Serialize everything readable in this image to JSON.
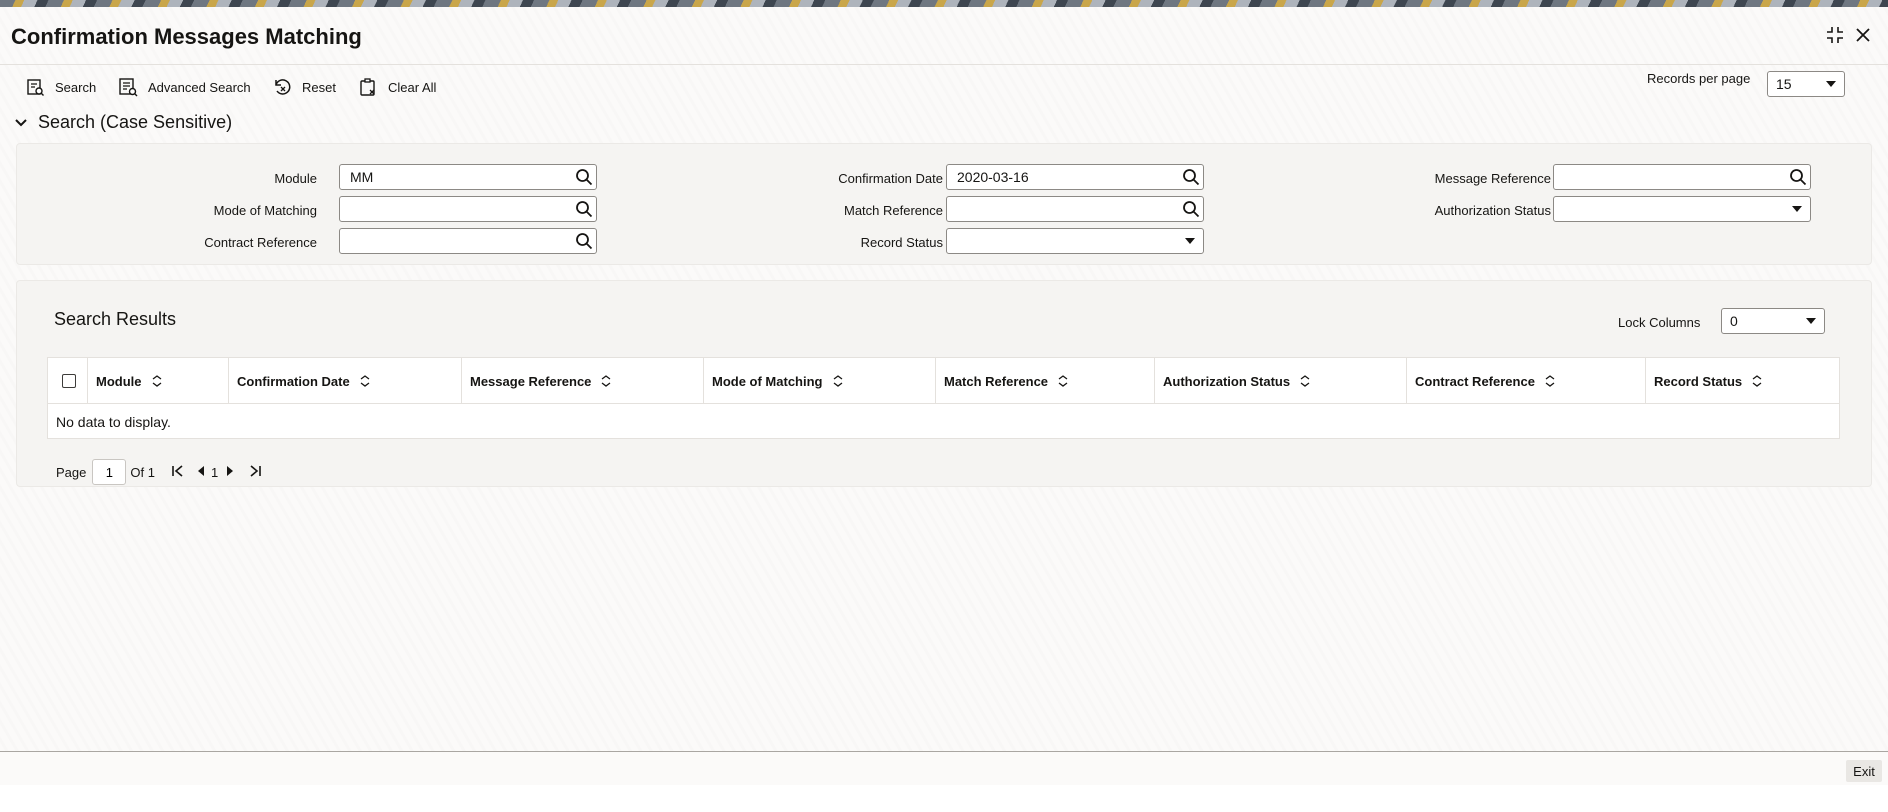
{
  "window": {
    "title": "Confirmation Messages Matching"
  },
  "toolbar": {
    "search": "Search",
    "advanced_search": "Advanced Search",
    "reset": "Reset",
    "clear_all": "Clear All",
    "records_per_page_label": "Records per page",
    "records_per_page_value": "15"
  },
  "search_section": {
    "title": "Search (Case Sensitive)",
    "fields": {
      "module": {
        "label": "Module",
        "value": "MM"
      },
      "mode_of_matching": {
        "label": "Mode of Matching",
        "value": ""
      },
      "contract_reference": {
        "label": "Contract Reference",
        "value": ""
      },
      "confirmation_date": {
        "label": "Confirmation Date",
        "value": "2020-03-16"
      },
      "match_reference": {
        "label": "Match Reference",
        "value": ""
      },
      "record_status": {
        "label": "Record Status",
        "value": ""
      },
      "message_reference": {
        "label": "Message Reference",
        "value": ""
      },
      "authorization_status": {
        "label": "Authorization Status",
        "value": ""
      }
    }
  },
  "results": {
    "title": "Search Results",
    "lock_columns_label": "Lock Columns",
    "lock_columns_value": "0",
    "columns": [
      "Module",
      "Confirmation Date",
      "Message Reference",
      "Mode of Matching",
      "Match Reference",
      "Authorization Status",
      "Contract Reference",
      "Record Status"
    ],
    "empty_text": "No data to display."
  },
  "pager": {
    "page_label": "Page",
    "page_value": "1",
    "of_label": "Of 1",
    "current": "1"
  },
  "footer": {
    "exit": "Exit"
  }
}
